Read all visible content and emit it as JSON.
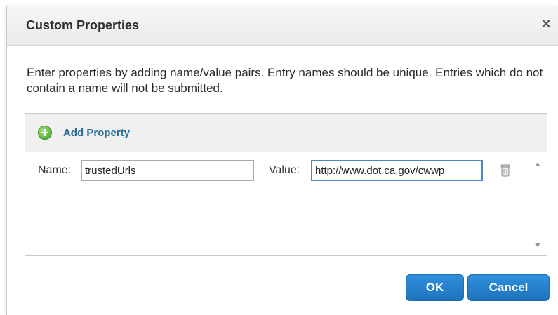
{
  "dialog": {
    "title": "Custom Properties",
    "close_icon": "close-icon",
    "close_glyph": "×",
    "instructions": "Enter properties by adding name/value pairs. Entry names should be unique. Entries which do not contain a name will not be submitted."
  },
  "panel": {
    "add_label": "Add Property",
    "add_icon": "add-circle-icon",
    "rows": [
      {
        "name_label": "Name:",
        "name_value": "trustedUrls",
        "value_label": "Value:",
        "value_value": "http://www.dot.ca.gov/cwwp",
        "delete_icon": "trash-icon"
      }
    ]
  },
  "buttons": {
    "ok_label": "OK",
    "cancel_label": "Cancel"
  },
  "colors": {
    "accent": "#1f73bd",
    "link": "#2a6d99",
    "focus_border": "#4a86c8",
    "add_icon_green": "#3fa324"
  }
}
